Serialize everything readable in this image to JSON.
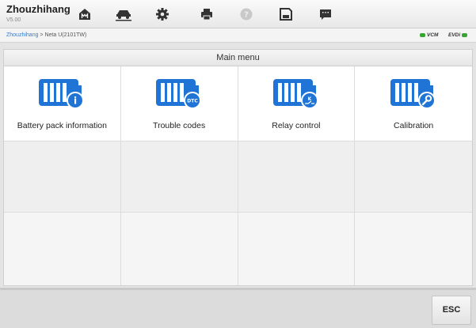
{
  "header": {
    "title": "Zhouzhihang",
    "version": "V5.00",
    "toolbar": [
      {
        "icon": "home-icon"
      },
      {
        "icon": "vehicle-lift-icon"
      },
      {
        "icon": "settings-gear-icon"
      },
      {
        "icon": "print-icon"
      },
      {
        "icon": "help-icon"
      },
      {
        "icon": "save-icon"
      },
      {
        "icon": "message-icon"
      }
    ]
  },
  "breadcrumb": {
    "link": "Zhouzhihang",
    "separator": " > ",
    "current": "Neta U(2101TW)"
  },
  "status": {
    "vcm": "VCM",
    "evdi": "EVDi",
    "connected_color": "#3aa335"
  },
  "main_menu": {
    "title": "Main menu",
    "items": [
      {
        "label": "Battery pack information",
        "badge": "i",
        "icon": "battery-info-icon"
      },
      {
        "label": "Trouble codes",
        "badge": "DTC",
        "icon": "battery-dtc-icon"
      },
      {
        "label": "Relay control",
        "badge": "K",
        "icon": "battery-relay-icon"
      },
      {
        "label": "Calibration",
        "badge": "",
        "icon": "battery-wrench-icon"
      }
    ]
  },
  "footer": {
    "esc_label": "ESC"
  },
  "colors": {
    "icon_blue": "#1f74d6",
    "link_blue": "#2b7fd8"
  }
}
